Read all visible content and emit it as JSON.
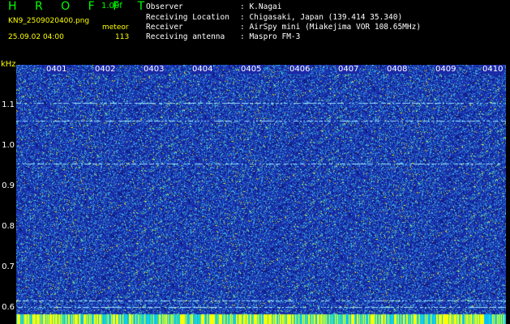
{
  "header": {
    "app_title": "H R O F F T",
    "version": "1.00f",
    "filename": "KN9_2509020400.png",
    "mode": "meteor",
    "datetime": "25.09.02 04:00",
    "count": "113"
  },
  "info": [
    {
      "key": "Observer",
      "value": ": K.Nagai"
    },
    {
      "key": "Receiving Location",
      "value": ": Chigasaki, Japan (139.414 35.340)"
    },
    {
      "key": "Receiver",
      "value": ": AirSpy mini (Miakejima VOR 108.65MHz)"
    },
    {
      "key": "Receiving antenna",
      "value": ": Maspro FM-3"
    }
  ],
  "axis": {
    "unit": "kHz",
    "y_ticks": [
      "1.1",
      "1.0",
      "0.9",
      "0.8",
      "0.7",
      "0.6"
    ],
    "x_ticks": [
      "0401",
      "0402",
      "0403",
      "0404",
      "0405",
      "0406",
      "0407",
      "0408",
      "0409",
      "0410"
    ]
  },
  "colors": {
    "background": "#1a2aa8",
    "noise_light": "#3aa0e0",
    "noise_hot": "#ffff00",
    "line": "#9fe8ff"
  }
}
